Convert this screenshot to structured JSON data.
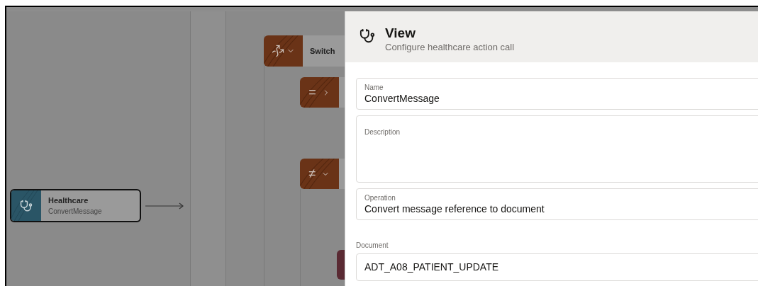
{
  "canvas": {
    "switch_node": {
      "label": "Switch",
      "expanded": true
    },
    "cases": [
      {
        "symbol": "=",
        "expanded": false
      },
      {
        "symbol": "≠",
        "expanded": true
      }
    ],
    "action_node": {
      "title": "Healthcare",
      "subtitle": "ConvertMessage",
      "selected": true
    }
  },
  "panel": {
    "title": "View",
    "subtitle": "Configure healthcare action call",
    "fields": [
      {
        "kind": "inline",
        "label": "Name",
        "value": "ConvertMessage"
      },
      {
        "kind": "textarea",
        "label": "Description"
      },
      {
        "kind": "inline",
        "label": "Operation",
        "value": "Convert message reference to document"
      },
      {
        "kind": "outside",
        "label": "Document",
        "value": "ADT_A08_PATIENT_UPDATE"
      }
    ]
  }
}
